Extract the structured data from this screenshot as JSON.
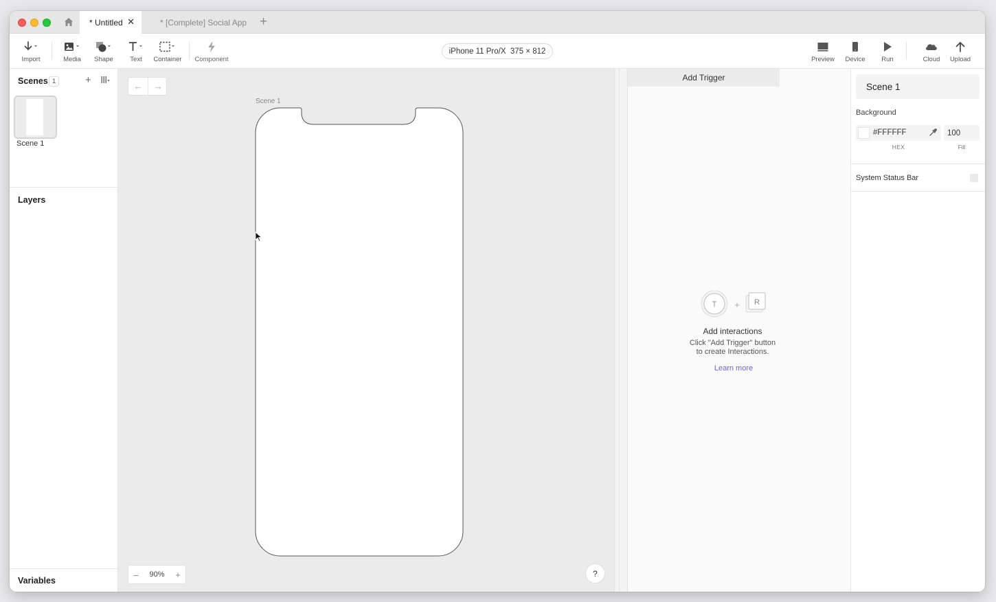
{
  "tabs": {
    "active_label": "* Untitled",
    "inactive_label": "* [Complete] Social App",
    "close_glyph": "✕",
    "add_glyph": "+"
  },
  "toolbar": {
    "import": "Import",
    "media": "Media",
    "shape": "Shape",
    "text": "Text",
    "container": "Container",
    "component": "Component",
    "device_selector": "iPhone 11 Pro/X  375 × 812",
    "preview": "Preview",
    "device": "Device",
    "run": "Run",
    "cloud": "Cloud",
    "upload": "Upload"
  },
  "scenes": {
    "title": "Scenes",
    "count": "1",
    "add_glyph": "+",
    "items": [
      {
        "label": "Scene 1"
      }
    ]
  },
  "layers": {
    "title": "Layers"
  },
  "variables": {
    "title": "Variables"
  },
  "canvas": {
    "back_glyph": "←",
    "forward_glyph": "→",
    "scene_label": "Scene 1",
    "zoom_minus": "–",
    "zoom_value": "90%",
    "zoom_plus": "+",
    "help": "?"
  },
  "interactions": {
    "tab_label": "Add Trigger",
    "trigger_letter": "T",
    "plus": "+",
    "response_letter": "R",
    "title": "Add interactions",
    "desc_line1": "Click \"Add Trigger\" button",
    "desc_line2": "to create Interactions.",
    "learn_more": "Learn more"
  },
  "properties": {
    "scene_name": "Scene 1",
    "background_label": "Background",
    "hex_value": "#FFFFFF",
    "fill_value": "100",
    "hex_caption": "HEX",
    "fill_caption": "Fill",
    "status_bar_label": "System Status Bar"
  },
  "colors": {
    "accent_link": "#6c63d9",
    "canvas_bg": "#ebebeb",
    "traffic_red": "#fe5f57",
    "traffic_yellow": "#febc2e",
    "traffic_green": "#28c840"
  }
}
